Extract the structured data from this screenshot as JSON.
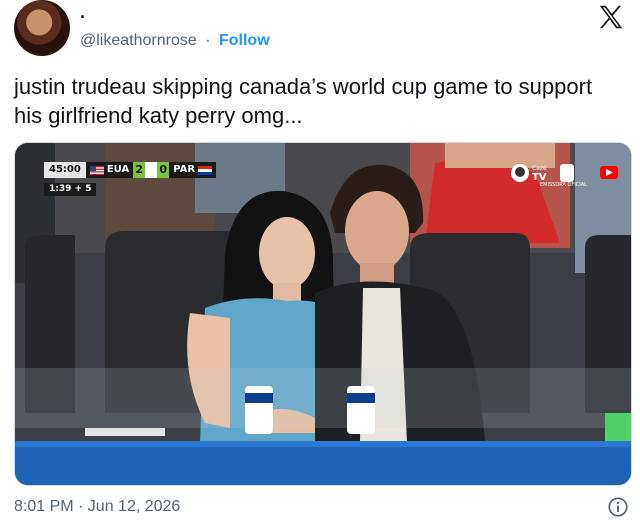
{
  "author": {
    "display_name": ".",
    "handle": "@likeathornrose",
    "separator": "·",
    "follow_label": "Follow"
  },
  "tweet": {
    "text": "justin trudeau skipping canada’s world cup game to support his girlfriend katy perry omg...",
    "timestamp": "8:01 PM · Jun 12, 2026"
  },
  "scorebug": {
    "clock": "45:00",
    "stoppage": "1:39 + 5",
    "home_team": "EUA",
    "home_score": "2",
    "away_team": "PAR",
    "away_score": "0"
  },
  "broadcaster": {
    "name": "Cazé TV",
    "tag": "EMISSORA OFICIAL"
  },
  "icons": [
    "x-logo-icon",
    "youtube-icon",
    "info-icon"
  ],
  "colors": {
    "link": "#1d9bf0",
    "text": "#0f1419",
    "muted": "#536471",
    "score": "#7bc144"
  }
}
